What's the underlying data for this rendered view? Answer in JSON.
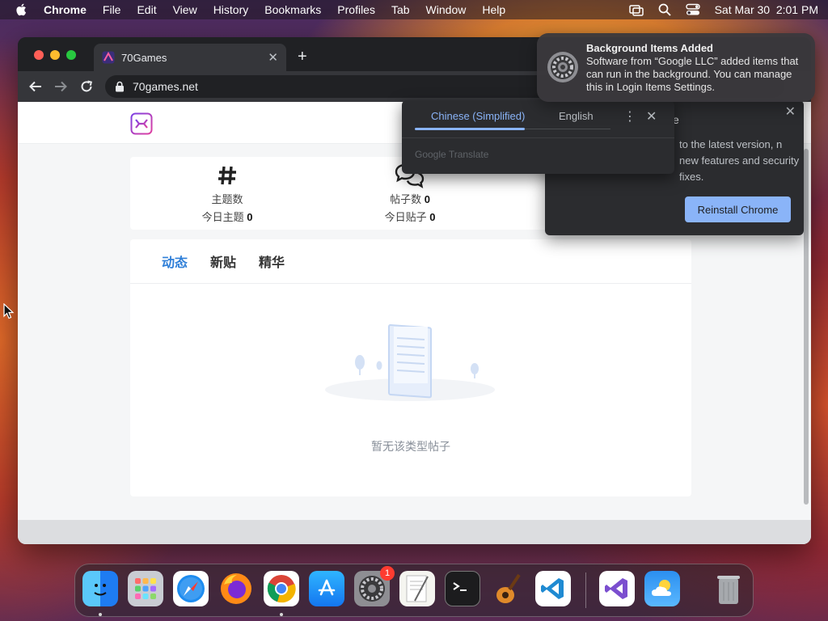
{
  "menubar": {
    "app_name": "Chrome",
    "menus": [
      "File",
      "Edit",
      "View",
      "History",
      "Bookmarks",
      "Profiles",
      "Tab",
      "Window",
      "Help"
    ],
    "datetime": "Sat Mar 30  2:01 PM"
  },
  "browser": {
    "tab_title": "70Games",
    "url": "70games.net"
  },
  "site": {
    "stats": {
      "topics_label": "主题数",
      "today_topics_label": "今日主题",
      "today_topics_value": "0",
      "posts_label": "帖子数",
      "posts_value": "0",
      "today_posts_label": "今日贴子",
      "today_posts_value": "0"
    },
    "feed_tabs": [
      "动态",
      "新贴",
      "精华"
    ],
    "active_tab": "动态",
    "empty_text": "暂无该类型帖子"
  },
  "translate_bubble": {
    "source_language": "Chinese (Simplified)",
    "target_language": "English",
    "footer": "Google Translate"
  },
  "reinstall_bubble": {
    "title_fragment": "e",
    "body": "to the latest version, n new features and security fixes.",
    "button_label": "Reinstall Chrome"
  },
  "notification": {
    "title": "Background Items Added",
    "body": "Software from “Google LLC” added items that can run in the background. You can manage this in Login Items Settings."
  },
  "dock": {
    "items": [
      "Finder",
      "Launchpad",
      "Safari",
      "Firefox",
      "Google Chrome",
      "App Store",
      "System Settings",
      "TextEdit",
      "Terminal",
      "GarageBand",
      "Visual Studio Code",
      "Visual Studio",
      "Weather",
      "Trash"
    ],
    "system_settings_badge": "1"
  },
  "colors": {
    "accent_blue": "#2f7fd8",
    "chrome_dark": "#202124",
    "chrome_toolbar": "#35363a",
    "reinstall_button": "#8ab4f8"
  }
}
